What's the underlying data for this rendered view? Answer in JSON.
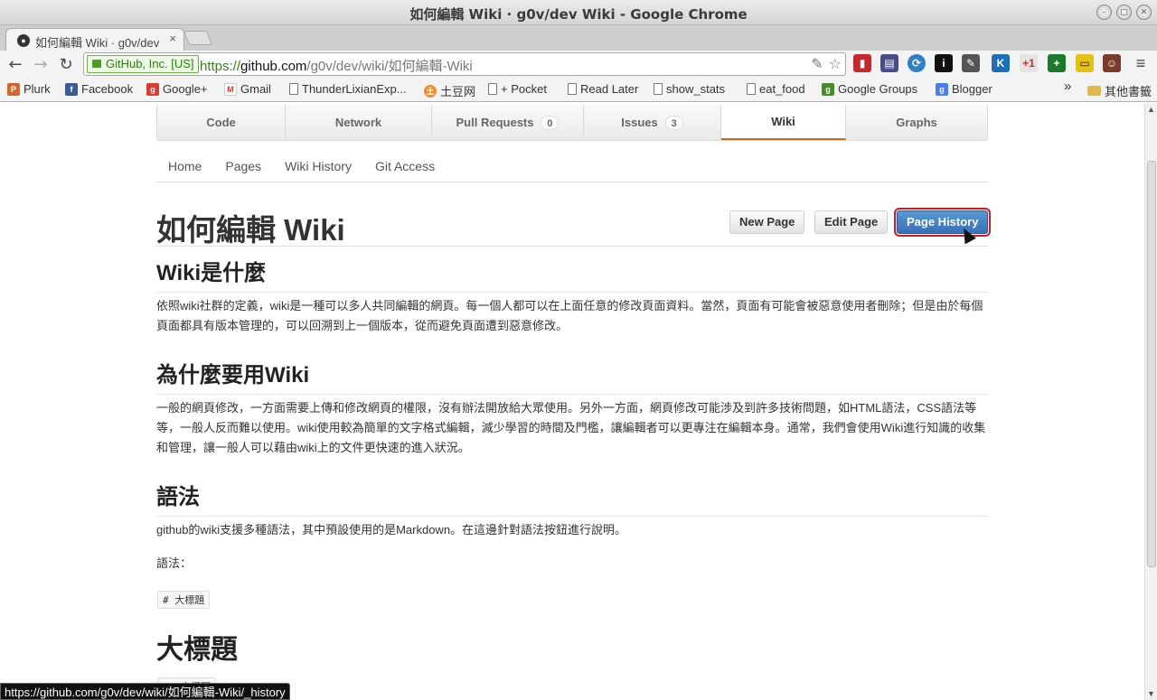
{
  "window": {
    "title": "如何編輯 Wiki · g0v/dev Wiki - Google Chrome",
    "controls": [
      "minimize",
      "maximize",
      "close"
    ]
  },
  "tab": {
    "label": "如何編輯 Wiki · g0v/dev",
    "close": "×",
    "favicon": "github-icon"
  },
  "toolbar": {
    "back": "←",
    "forward": "→",
    "reload": "↻",
    "ev_badge": "GitHub, Inc. [US]",
    "url_scheme": "https://",
    "url_host": "github.com",
    "url_path": "/g0v/dev/wiki/如何編輯-Wiki",
    "star": "☆"
  },
  "bookmarks": {
    "items": [
      "Plurk",
      "Facebook",
      "Google+",
      "Gmail",
      "ThunderLixianExp...",
      "土豆网",
      "+ Pocket",
      "Read Later",
      "show_stats",
      "eat_food",
      "Google Groups",
      "Blogger"
    ],
    "overflow": "»",
    "other": "其他書籤"
  },
  "repo_nav": {
    "tabs": [
      {
        "label": "Code",
        "count": ""
      },
      {
        "label": "Network",
        "count": ""
      },
      {
        "label": "Pull Requests",
        "count": "0"
      },
      {
        "label": "Issues",
        "count": "3"
      },
      {
        "label": "Wiki",
        "count": ""
      },
      {
        "label": "Graphs",
        "count": ""
      }
    ],
    "selected": "Wiki",
    "accent": "#d26911"
  },
  "wiki_nav": [
    "Home",
    "Pages",
    "Wiki History",
    "Git Access"
  ],
  "page": {
    "title": "如何編輯 Wiki",
    "buttons": {
      "new_page": "New Page",
      "edit_page": "Edit Page",
      "page_history": "Page History"
    },
    "sections": [
      {
        "heading": "Wiki是什麼",
        "text": "依照wiki社群的定義，wiki是一種可以多人共同編輯的網頁。每一個人都可以在上面任意的修改頁面資料。當然，頁面有可能會被惡意使用者刪除；但是由於每個頁面都具有版本管理的，可以回溯到上一個版本，從而避免頁面遭到惡意修改。"
      },
      {
        "heading": "為什麼要用Wiki",
        "text": "一般的網頁修改，一方面需要上傳和修改網頁的權限，沒有辦法開放給大眾使用。另外一方面，網頁修改可能涉及到許多技術問題，如HTML語法，CSS語法等等，一般人反而難以使用。wiki使用較為簡單的文字格式編輯，減少學習的時間及門檻，讓編輯者可以更專注在編輯本身。通常，我們會使用Wiki進行知識的收集和管理，讓一般人可以藉由wiki上的文件更快速的進入狀況。"
      },
      {
        "heading": "語法",
        "text": "github的wiki支援多種語法，其中預設使用的是Markdown。在這邊針對語法按鈕進行說明。"
      }
    ],
    "syntax_label": "語法：",
    "code_sample": "# 大標題",
    "sample_heading": "大標題",
    "code_sample_2": "## 大標題"
  },
  "status_bar": {
    "url": "https://github.com/g0v/dev/wiki/如何編輯-Wiki/_history"
  },
  "colors": {
    "primary_button": "#3670b6",
    "highlight_outline": "#d21920",
    "ev_green": "#2f7d12"
  }
}
